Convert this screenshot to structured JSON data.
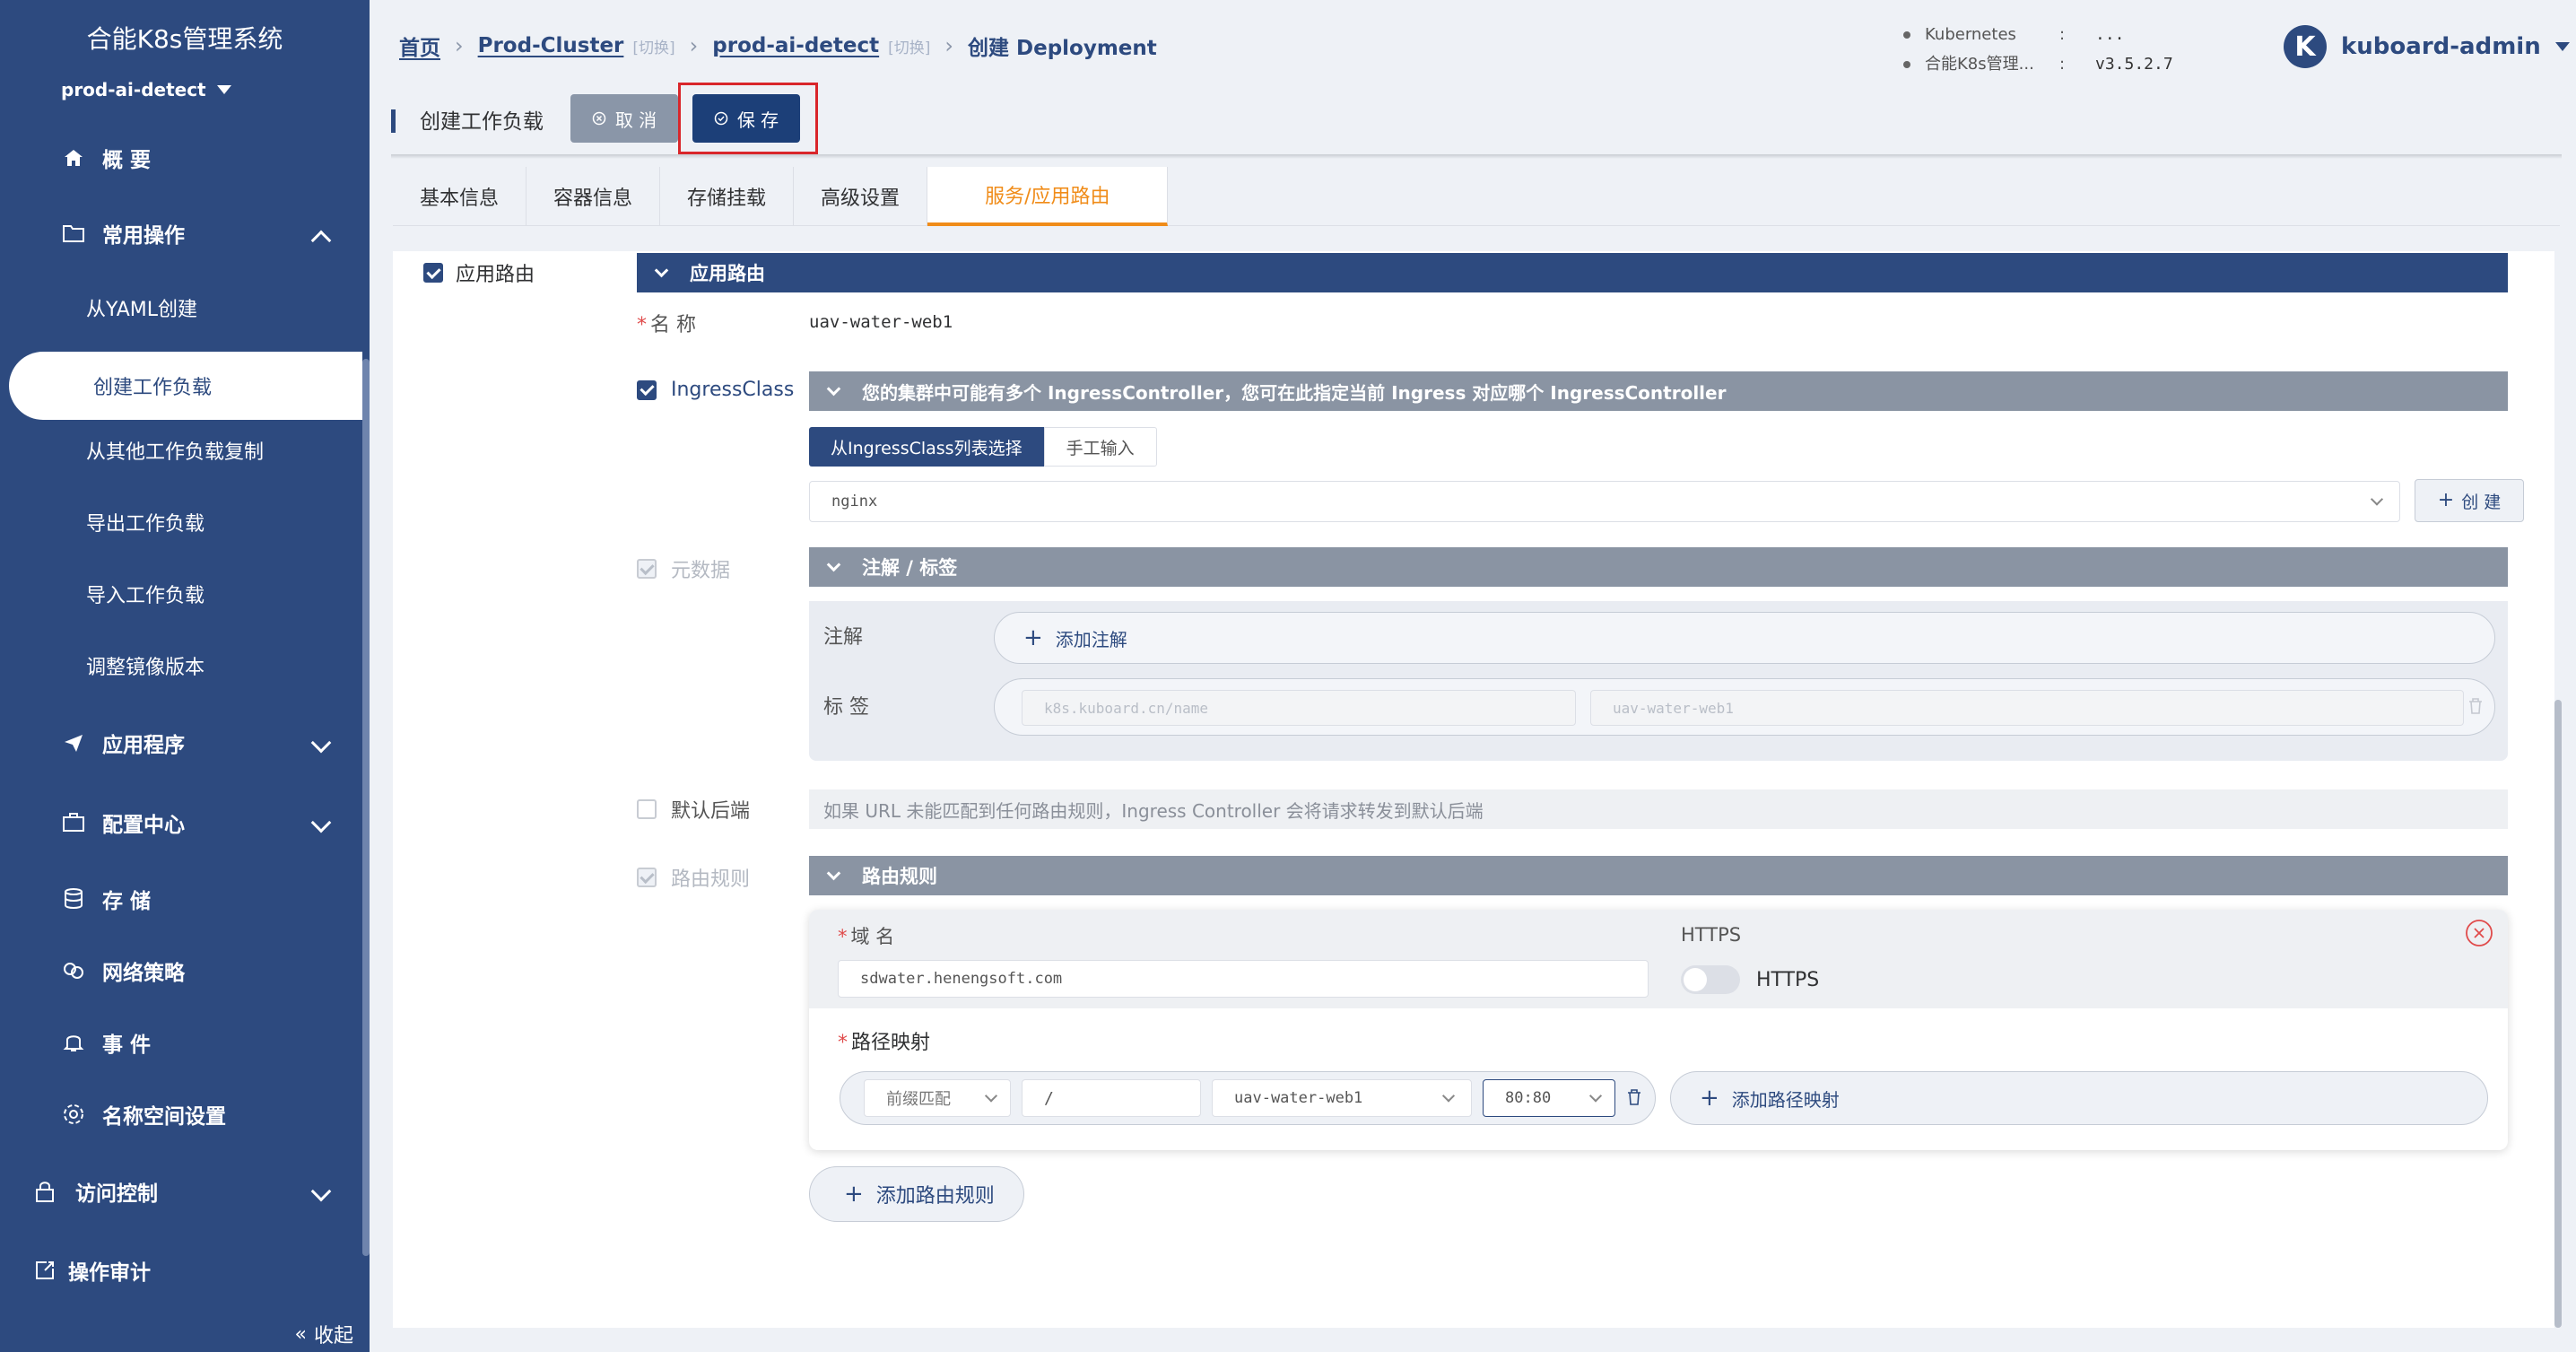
{
  "sidebar": {
    "brand": "合能K8s管理系统",
    "namespace": "prod-ai-detect",
    "items": [
      {
        "label": "概 要",
        "icon": "home-icon"
      },
      {
        "label": "常用操作",
        "icon": "folder-icon"
      },
      {
        "label": "从YAML创建"
      },
      {
        "label": "创建工作负载"
      },
      {
        "label": "从其他工作负载复制"
      },
      {
        "label": "导出工作负载"
      },
      {
        "label": "导入工作负载"
      },
      {
        "label": "调整镜像版本"
      },
      {
        "label": "应用程序",
        "icon": "send-icon"
      },
      {
        "label": "配置中心",
        "icon": "briefcase-icon"
      },
      {
        "label": "存 储",
        "icon": "database-icon"
      },
      {
        "label": "网络策略",
        "icon": "network-icon"
      },
      {
        "label": "事 件",
        "icon": "bell-icon"
      },
      {
        "label": "名称空间设置",
        "icon": "gear-icon"
      },
      {
        "label": "访问控制",
        "icon": "lock-icon"
      },
      {
        "label": "操作审计",
        "icon": "audit-icon"
      }
    ],
    "collapse_label": "收起"
  },
  "breadcrumb": {
    "home": "首页",
    "cluster": "Prod-Cluster",
    "cluster_switch": "[切换]",
    "namespace": "prod-ai-detect",
    "namespace_switch": "[切换]",
    "current": "创建 Deployment"
  },
  "sysinfo": [
    {
      "key": "Kubernetes",
      "colon": ":",
      "value": "..."
    },
    {
      "key": "合能K8s管理...",
      "colon": ":",
      "value": "v3.5.2.7"
    }
  ],
  "user": {
    "avatar_letter": "K",
    "name": "kuboard-admin"
  },
  "toolbar": {
    "title": "创建工作负载",
    "cancel_label": "取 消",
    "save_label": "保 存"
  },
  "tabs": [
    "基本信息",
    "容器信息",
    "存储挂载",
    "高级设置",
    "服务/应用路由"
  ],
  "ingress": {
    "enable_label": "应用路由",
    "section_title": "应用路由",
    "name_label": "名 称",
    "name_value": "uav-water-web1",
    "ingress_class_label": "IngressClass",
    "ingress_class_hint": "您的集群中可能有多个 IngressController，您可在此指定当前 Ingress 对应哪个 IngressController",
    "select_from_list": "从IngressClass列表选择",
    "manual_input": "手工输入",
    "ingress_class_value": "nginx",
    "create_label": "创 建",
    "metadata_label": "元数据",
    "metadata_title": "注解 / 标签",
    "annotations_label": "注解",
    "add_annotation": "添加注解",
    "labels_label": "标 签",
    "label_key": "k8s.kuboard.cn/name",
    "label_value": "uav-water-web1",
    "default_backend_label": "默认后端",
    "default_backend_hint": "如果 URL 未能匹配到任何路由规则，Ingress Controller 会将请求转发到默认后端",
    "rules_label": "路由规则",
    "rules_title": "路由规则",
    "domain_label": "域 名",
    "domain_value": "sdwater.henengsoft.com",
    "https_label": "HTTPS",
    "https_toggle_label": "HTTPS",
    "path_mapping_label": "路径映射",
    "path_type": "前缀匹配",
    "path_value": "/",
    "service_value": "uav-water-web1",
    "port_value": "80:80",
    "add_path_mapping": "添加路径映射",
    "add_rule": "添加路由规则"
  },
  "colors": {
    "primary": "#2d4a7f",
    "accent": "#f08c19",
    "danger": "#e04b4b"
  }
}
